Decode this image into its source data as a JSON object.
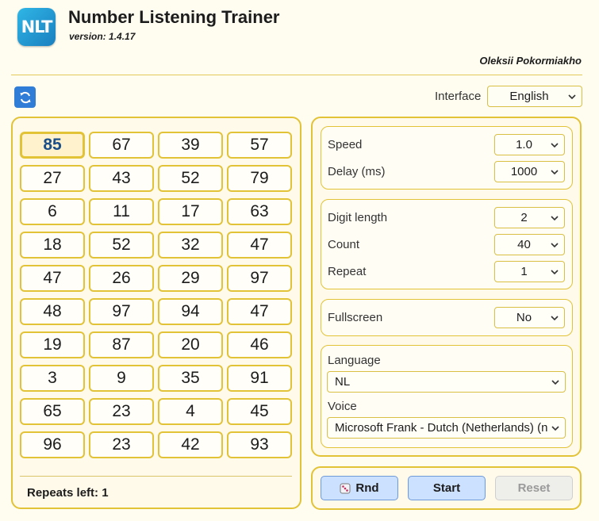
{
  "header": {
    "logo_text": "NLT",
    "title": "Number Listening Trainer",
    "version": "version: 1.4.17",
    "author": "Oleksii Pokormiakho"
  },
  "toolbar": {
    "refresh_icon": "refresh-icon",
    "interface_label": "Interface",
    "interface_value": "English"
  },
  "numbers": {
    "active_index": 0,
    "items": [
      "85",
      "67",
      "39",
      "57",
      "27",
      "43",
      "52",
      "79",
      "6",
      "11",
      "17",
      "63",
      "18",
      "52",
      "32",
      "47",
      "47",
      "26",
      "29",
      "97",
      "48",
      "97",
      "94",
      "47",
      "19",
      "87",
      "20",
      "46",
      "3",
      "9",
      "35",
      "91",
      "65",
      "23",
      "4",
      "45",
      "96",
      "23",
      "42",
      "93"
    ],
    "repeats_left": "Repeats left: 1"
  },
  "settings": {
    "speed_label": "Speed",
    "speed_value": "1.0",
    "delay_label": "Delay (ms)",
    "delay_value": "1000",
    "digit_length_label": "Digit length",
    "digit_length_value": "2",
    "count_label": "Count",
    "count_value": "40",
    "repeat_label": "Repeat",
    "repeat_value": "1",
    "fullscreen_label": "Fullscreen",
    "fullscreen_value": "No",
    "language_label": "Language",
    "language_value": "NL",
    "voice_label": "Voice",
    "voice_value": "Microsoft Frank - Dutch (Netherlands) (n"
  },
  "actions": {
    "rnd_label": "Rnd",
    "rnd_icon": "dice-icon",
    "start_label": "Start",
    "reset_label": "Reset"
  },
  "colors": {
    "accent": "#e2c237",
    "background": "#fffdf0",
    "button_blue": "#cce0ff",
    "active_text": "#1b4f8a"
  }
}
